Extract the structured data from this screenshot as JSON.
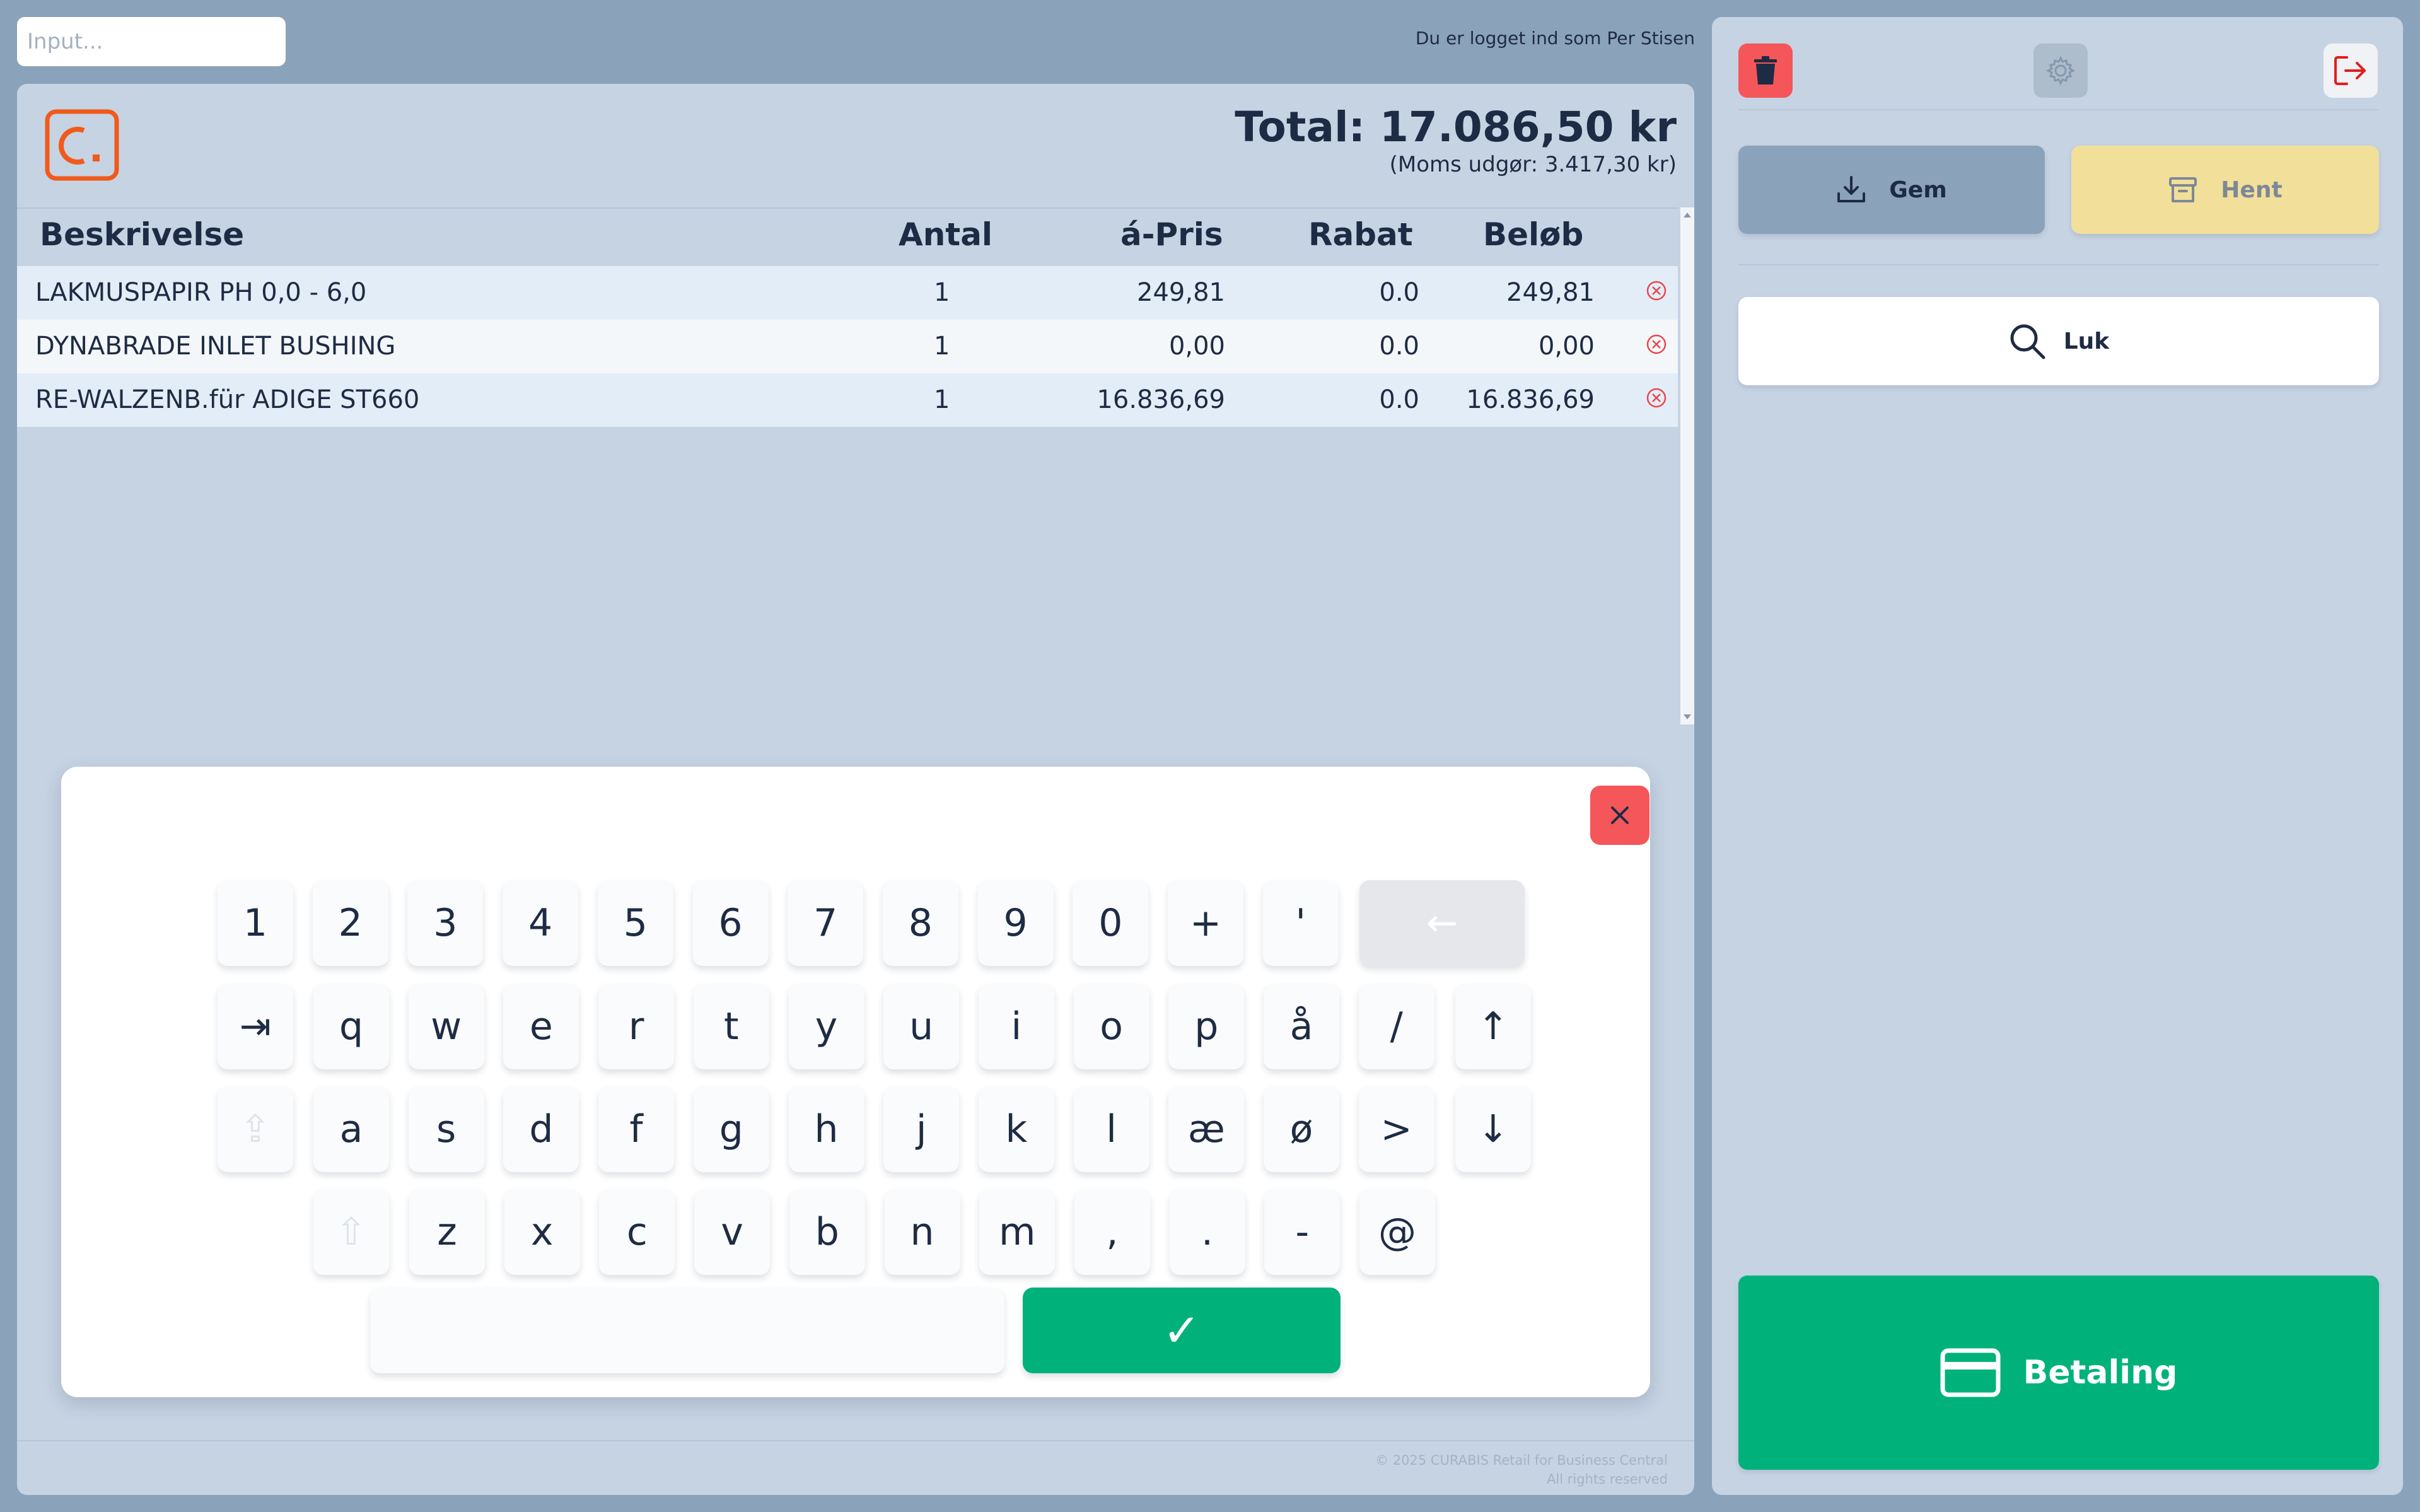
{
  "top": {
    "input_placeholder": "Input...",
    "logged_in": "Du er logget ind som Per Stisen"
  },
  "totals": {
    "total": "Total: 17.086,50 kr",
    "vat": "(Moms udgør: 3.417,30 kr)"
  },
  "table": {
    "headers": {
      "description": "Beskrivelse",
      "quantity": "Antal",
      "unit_price": "á-Pris",
      "discount": "Rabat",
      "amount": "Beløb"
    },
    "rows": [
      {
        "description": "LAKMUSPAPIR PH 0,0 - 6,0",
        "quantity": "1",
        "unit_price": "249,81",
        "discount": "0.0",
        "amount": "249,81"
      },
      {
        "description": "DYNABRADE INLET BUSHING",
        "quantity": "1",
        "unit_price": "0,00",
        "discount": "0.0",
        "amount": "0,00"
      },
      {
        "description": "RE-WALZENB.für ADIGE ST660",
        "quantity": "1",
        "unit_price": "16.836,69",
        "discount": "0.0",
        "amount": "16.836,69"
      }
    ]
  },
  "keyboard": {
    "row1": [
      "1",
      "2",
      "3",
      "4",
      "5",
      "6",
      "7",
      "8",
      "9",
      "0",
      "+",
      "'"
    ],
    "backspace": "←",
    "tab": "⇥",
    "row2": [
      "q",
      "w",
      "e",
      "r",
      "t",
      "y",
      "u",
      "i",
      "o",
      "p",
      "å",
      "/"
    ],
    "up": "↑",
    "caps": "⇪",
    "row3": [
      "a",
      "s",
      "d",
      "f",
      "g",
      "h",
      "j",
      "k",
      "l",
      "æ",
      "ø",
      ">"
    ],
    "down": "↓",
    "shift": "⇧",
    "row4": [
      "z",
      "x",
      "c",
      "v",
      "b",
      "n",
      "m",
      ",",
      ".",
      "-",
      "@"
    ],
    "ok": "✓"
  },
  "footer": {
    "line1": "© 2025 CURABIS Retail for Business Central",
    "line2": "All rights reserved"
  },
  "right_panel": {
    "gem_label": "Gem",
    "hent_label": "Hent",
    "luk_label": "Luk",
    "betaling_label": "Betaling"
  },
  "colors": {
    "background": "#8aa3ba",
    "panel": "#c6d3e3",
    "accent_green": "#00b27a",
    "danger_red": "#f4565a",
    "logo_orange": "#f05a1a",
    "hent_yellow": "#f2df99",
    "text_dark": "#1e2b44"
  }
}
